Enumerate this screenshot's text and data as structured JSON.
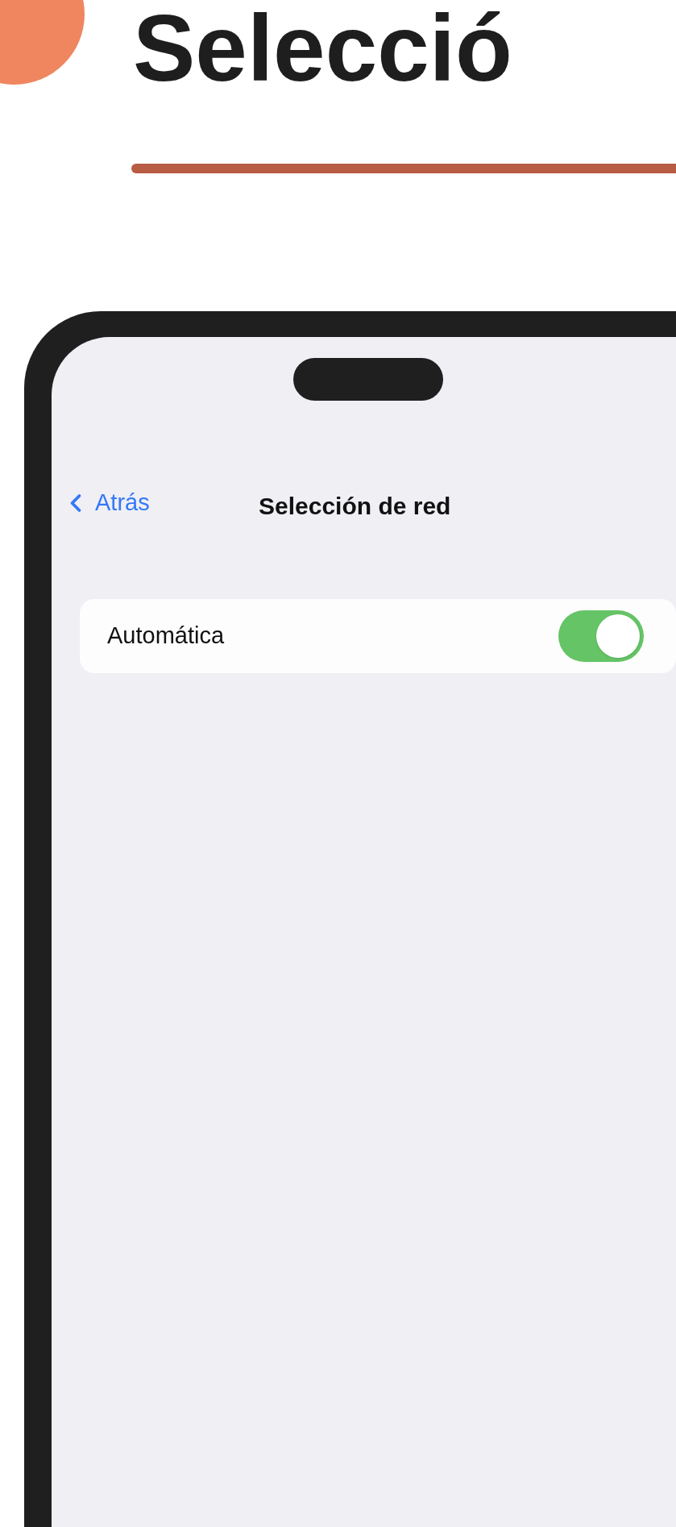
{
  "header": {
    "title": "Selecció"
  },
  "screen": {
    "nav": {
      "back": "Atrás",
      "title": "Selección de red"
    },
    "settings": [
      {
        "label": "Automática",
        "kind": "toggle",
        "on": true
      }
    ]
  }
}
